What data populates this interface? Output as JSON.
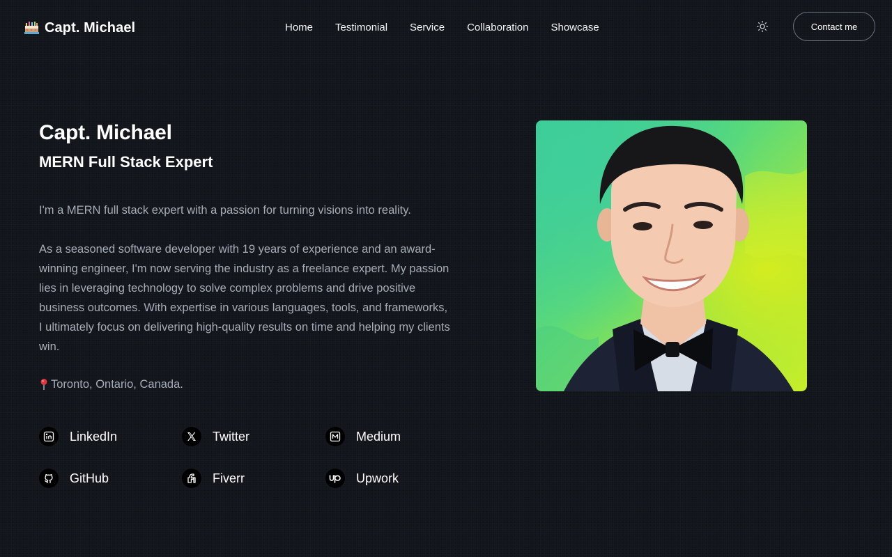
{
  "brand": {
    "name": "Capt. Michael",
    "logo_icon": "pixel-cake-logo-icon"
  },
  "nav": {
    "items": [
      "Home",
      "Testimonial",
      "Service",
      "Collaboration",
      "Showcase"
    ]
  },
  "header": {
    "theme_toggle_icon": "sun-icon",
    "contact_label": "Contact me"
  },
  "hero": {
    "name": "Capt. Michael",
    "role": "MERN Full Stack Expert",
    "intro": "I'm a MERN full stack expert with a passion for turning visions into reality.",
    "bio": "As a seasoned software developer with 19 years of experience and an award-winning engineer, I'm now serving the industry as a freelance expert. My passion lies in leveraging technology to solve complex problems and drive positive business outcomes. With expertise in various languages, tools, and frameworks, I ultimately focus on delivering high-quality results on time and helping my clients win.",
    "location": "Toronto, Ontario, Canada.",
    "location_icon": "map-pin-icon"
  },
  "socials": [
    {
      "label": "LinkedIn",
      "icon": "linkedin-icon"
    },
    {
      "label": "Twitter",
      "icon": "x-twitter-icon"
    },
    {
      "label": "Medium",
      "icon": "medium-icon"
    },
    {
      "label": "GitHub",
      "icon": "github-icon"
    },
    {
      "label": "Fiverr",
      "icon": "fiverr-icon"
    },
    {
      "label": "Upwork",
      "icon": "upwork-icon"
    }
  ],
  "colors": {
    "background": "#12161b",
    "text_primary": "#ffffff",
    "text_muted": "#a7adb7",
    "button_border": "#6b7280",
    "portrait_bg_green": "#5ad97a",
    "portrait_bg_yellow": "#c7ee2a"
  }
}
